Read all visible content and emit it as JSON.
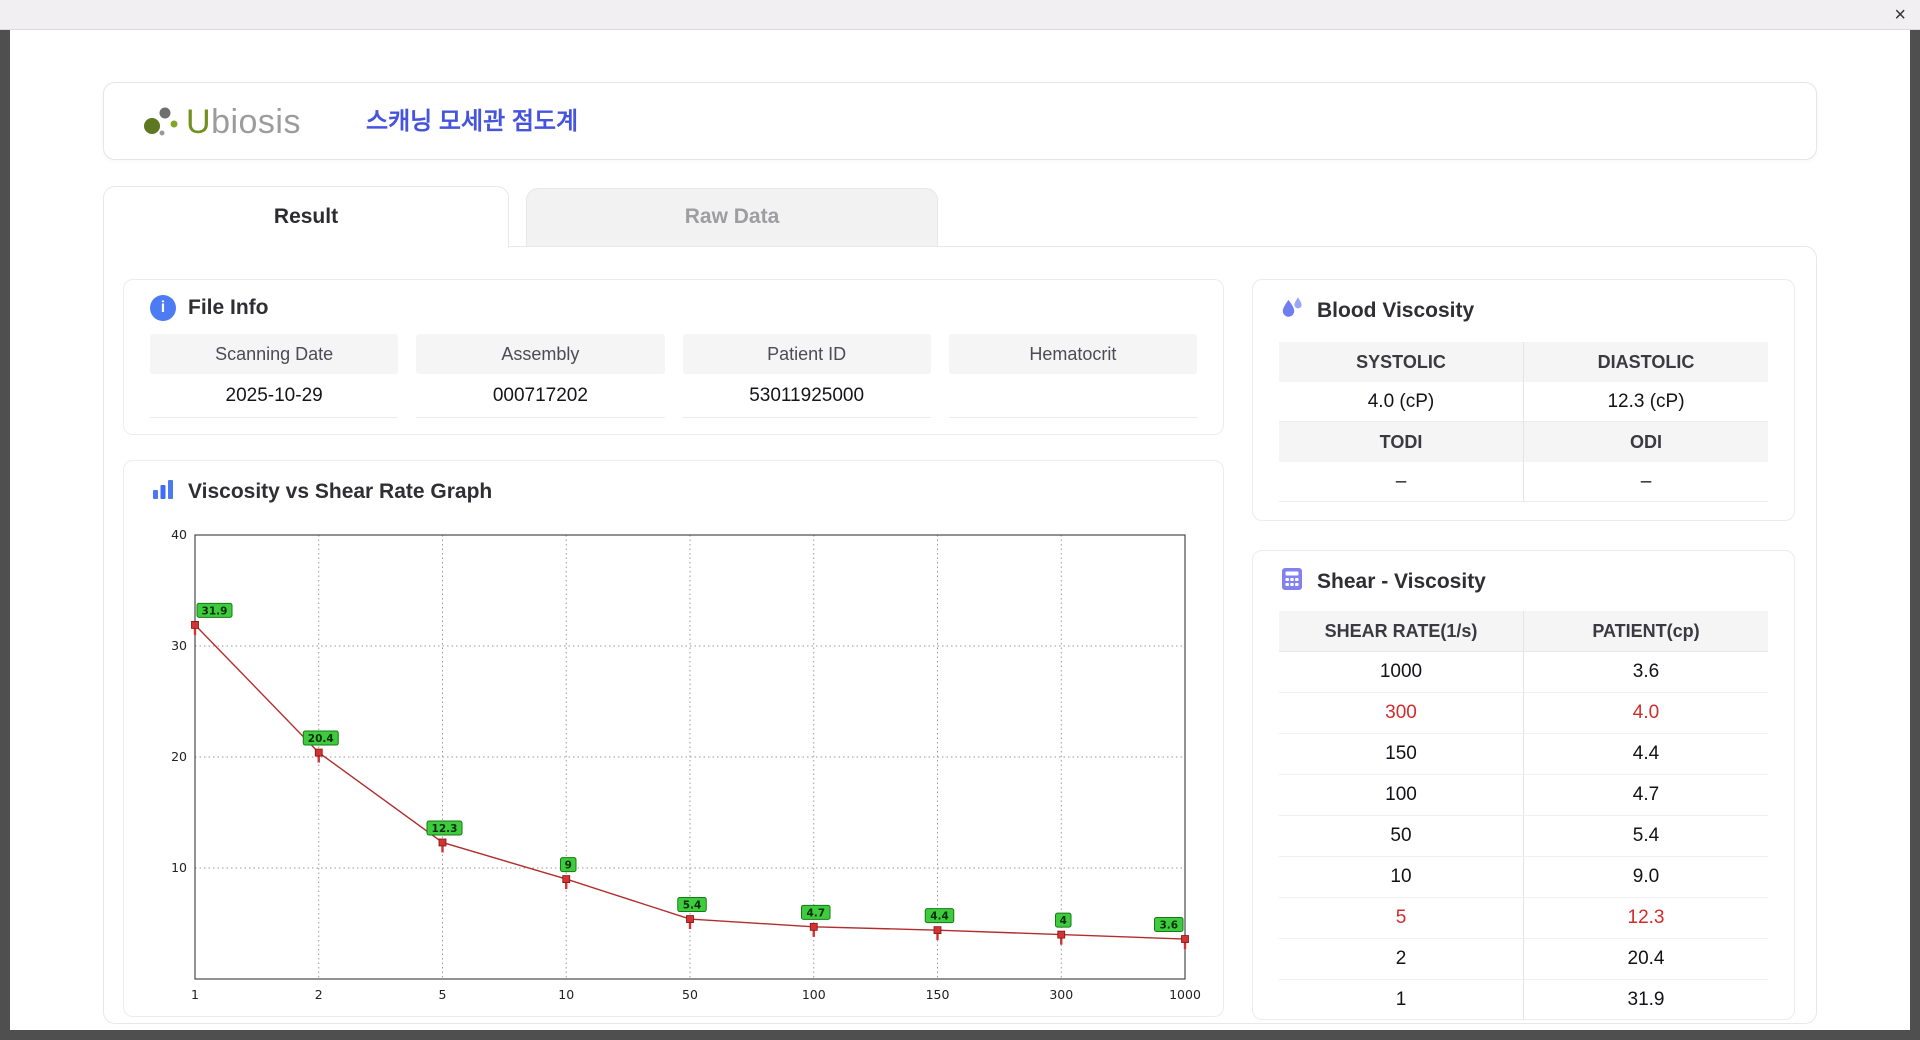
{
  "window": {
    "close_glyph": "×"
  },
  "header": {
    "logo_u": "U",
    "logo_rest": "biosis",
    "title": "스캐닝 모세관 점도계"
  },
  "tabs": [
    {
      "label": "Result",
      "active": true
    },
    {
      "label": "Raw Data",
      "active": false
    }
  ],
  "file_info": {
    "title": "File Info",
    "info_glyph": "i",
    "fields": [
      {
        "label": "Scanning Date",
        "value": "2025-10-29"
      },
      {
        "label": "Assembly",
        "value": "000717202"
      },
      {
        "label": "Patient ID",
        "value": "53011925000"
      },
      {
        "label": "Hematocrit",
        "value": ""
      }
    ]
  },
  "graph": {
    "title": "Viscosity vs Shear Rate Graph"
  },
  "chart_data": {
    "type": "line",
    "title": "Viscosity vs Shear Rate Graph",
    "categories": [
      "1",
      "2",
      "5",
      "10",
      "50",
      "100",
      "150",
      "300",
      "1000"
    ],
    "values": [
      31.9,
      20.4,
      12.3,
      9,
      5.4,
      4.7,
      4.4,
      4,
      3.6
    ],
    "point_labels": [
      "31.9",
      "20.4",
      "12.3",
      "9",
      "5.4",
      "4.7",
      "4.4",
      "4",
      "3.6"
    ],
    "xlabel": "",
    "ylabel": "",
    "ylim": [
      0,
      40
    ],
    "yticks": [
      10,
      20,
      30,
      40
    ],
    "grid": true,
    "legend": false,
    "line_color": "#b22e2e",
    "marker_color": "#d43333",
    "point_label_fill": "#3ecc3e"
  },
  "blood_viscosity": {
    "title": "Blood Viscosity",
    "rows": [
      {
        "h1": "SYSTOLIC",
        "h2": "DIASTOLIC",
        "v1": "4.0 (cP)",
        "v2": "12.3 (cP)"
      },
      {
        "h1": "TODI",
        "h2": "ODI",
        "v1": "–",
        "v2": "–"
      }
    ]
  },
  "shear_table": {
    "title": "Shear - Viscosity",
    "col1": "SHEAR RATE(1/s)",
    "col2": "PATIENT(cp)",
    "rows": [
      {
        "shear": "1000",
        "patient": "3.6",
        "highlight": false
      },
      {
        "shear": "300",
        "patient": "4.0",
        "highlight": true
      },
      {
        "shear": "150",
        "patient": "4.4",
        "highlight": false
      },
      {
        "shear": "100",
        "patient": "4.7",
        "highlight": false
      },
      {
        "shear": "50",
        "patient": "5.4",
        "highlight": false
      },
      {
        "shear": "10",
        "patient": "9.0",
        "highlight": false
      },
      {
        "shear": "5",
        "patient": "12.3",
        "highlight": true
      },
      {
        "shear": "2",
        "patient": "20.4",
        "highlight": false
      },
      {
        "shear": "1",
        "patient": "31.9",
        "highlight": false
      }
    ]
  },
  "icons": [
    "close-icon",
    "info-icon",
    "bar-chart-icon",
    "droplet-icon",
    "table-icon",
    "ubiosis-logo-icon"
  ]
}
